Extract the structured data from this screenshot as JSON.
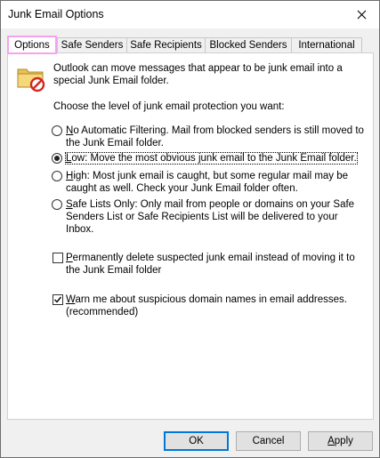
{
  "window": {
    "title": "Junk Email Options",
    "close_icon": "close-icon"
  },
  "tabs": [
    {
      "label": "Options",
      "active": true
    },
    {
      "label": "Safe Senders"
    },
    {
      "label": "Safe Recipients"
    },
    {
      "label": "Blocked Senders"
    },
    {
      "label": "International"
    }
  ],
  "options_panel": {
    "intro_text": "Outlook can move messages that appear to be junk email into a special Junk Email folder.",
    "level_heading": "Choose the level of junk email protection you want:",
    "levels": [
      {
        "hotkey": "N",
        "rest": "o Automatic Filtering. Mail from blocked senders is still moved to the Junk Email folder.",
        "selected": false
      },
      {
        "hotkey": "L",
        "rest": "ow: Move the most obvious junk email to the Junk Email folder.",
        "selected": true
      },
      {
        "hotkey": "H",
        "rest": "igh: Most junk email is caught, but some regular mail may be caught as well. Check your Junk Email folder often.",
        "selected": false
      },
      {
        "hotkey": "S",
        "rest": "afe Lists Only: Only mail from people or domains on your Safe Senders List or Safe Recipients List will be delivered to your Inbox.",
        "selected": false
      }
    ],
    "permanent_delete": {
      "hotkey": "P",
      "rest": "ermanently delete suspected junk email instead of moving it to the Junk Email folder",
      "checked": false
    },
    "warn_domains": {
      "hotkey": "W",
      "rest": "arn me about suspicious domain names in email addresses. (recommended)",
      "checked": true
    }
  },
  "buttons": {
    "ok": "OK",
    "cancel": "Cancel",
    "apply_hotkey": "A",
    "apply_rest": "pply"
  },
  "colors": {
    "active_tab_highlight": "#f5a3f0",
    "default_button_border": "#0078d7"
  }
}
